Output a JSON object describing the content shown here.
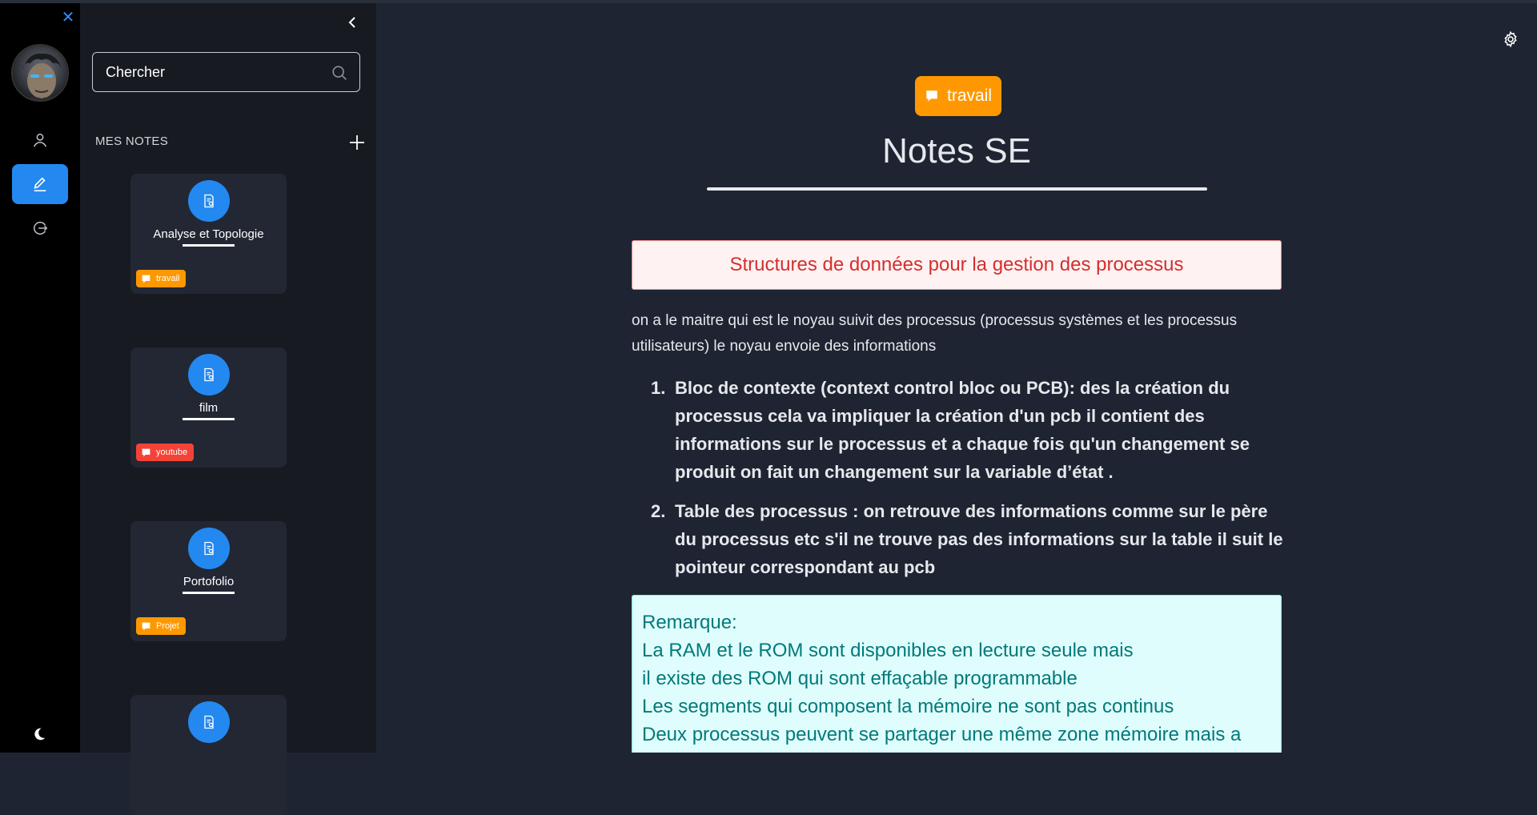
{
  "rail": {
    "close_glyph": "✕",
    "items": [
      {
        "icon": "user-icon"
      },
      {
        "icon": "edit-icon",
        "active": true
      },
      {
        "icon": "logout-icon"
      }
    ],
    "theme_icon": "moon-icon"
  },
  "sidebar": {
    "search_placeholder": "Chercher",
    "section_title": "MES NOTES",
    "notes": [
      {
        "title": "Analyse et Topologie",
        "tag": "travail",
        "tag_color": "#ff9800"
      },
      {
        "title": "film",
        "tag": "youtube",
        "tag_color": "#f44336"
      },
      {
        "title": "Portofolio",
        "tag": "Projet",
        "tag_color": "#ff9800"
      },
      {
        "title": "",
        "tag": "",
        "tag_color": "#ff9800"
      }
    ]
  },
  "main": {
    "tag": "travail",
    "title": "Notes SE",
    "heading": "Structures de données pour la gestion des processus",
    "paragraph": "on a le maitre qui est le noyau suivit des processus (processus systèmes et les processus utilisateurs) le noyau envoie des informations",
    "list": [
      {
        "num": "1.",
        "text": "Bloc de contexte (context control bloc ou PCB): des la création du processus cela va impliquer la création d'un pcb il contient des informations sur le processus et a chaque fois qu'un changement se produit on fait un changement sur la variable d’état ."
      },
      {
        "num": "2.",
        "text": "Table des processus : on retrouve des informations comme  sur le père du processus etc s'il ne trouve pas des informations sur la table il suit le pointeur correspondant au pcb"
      }
    ],
    "remark": [
      "Remarque:",
      "La RAM et le ROM sont disponibles  en lecture seule  mais",
      "il existe des ROM qui sont effaçable programmable",
      "Les segments qui composent la mémoire ne sont pas continus",
      "Deux processus peuvent se partager une même zone mémoire mais a"
    ]
  },
  "colors": {
    "accent": "#2388f0",
    "tag_orange": "#ff9800",
    "tag_red": "#f44336"
  }
}
